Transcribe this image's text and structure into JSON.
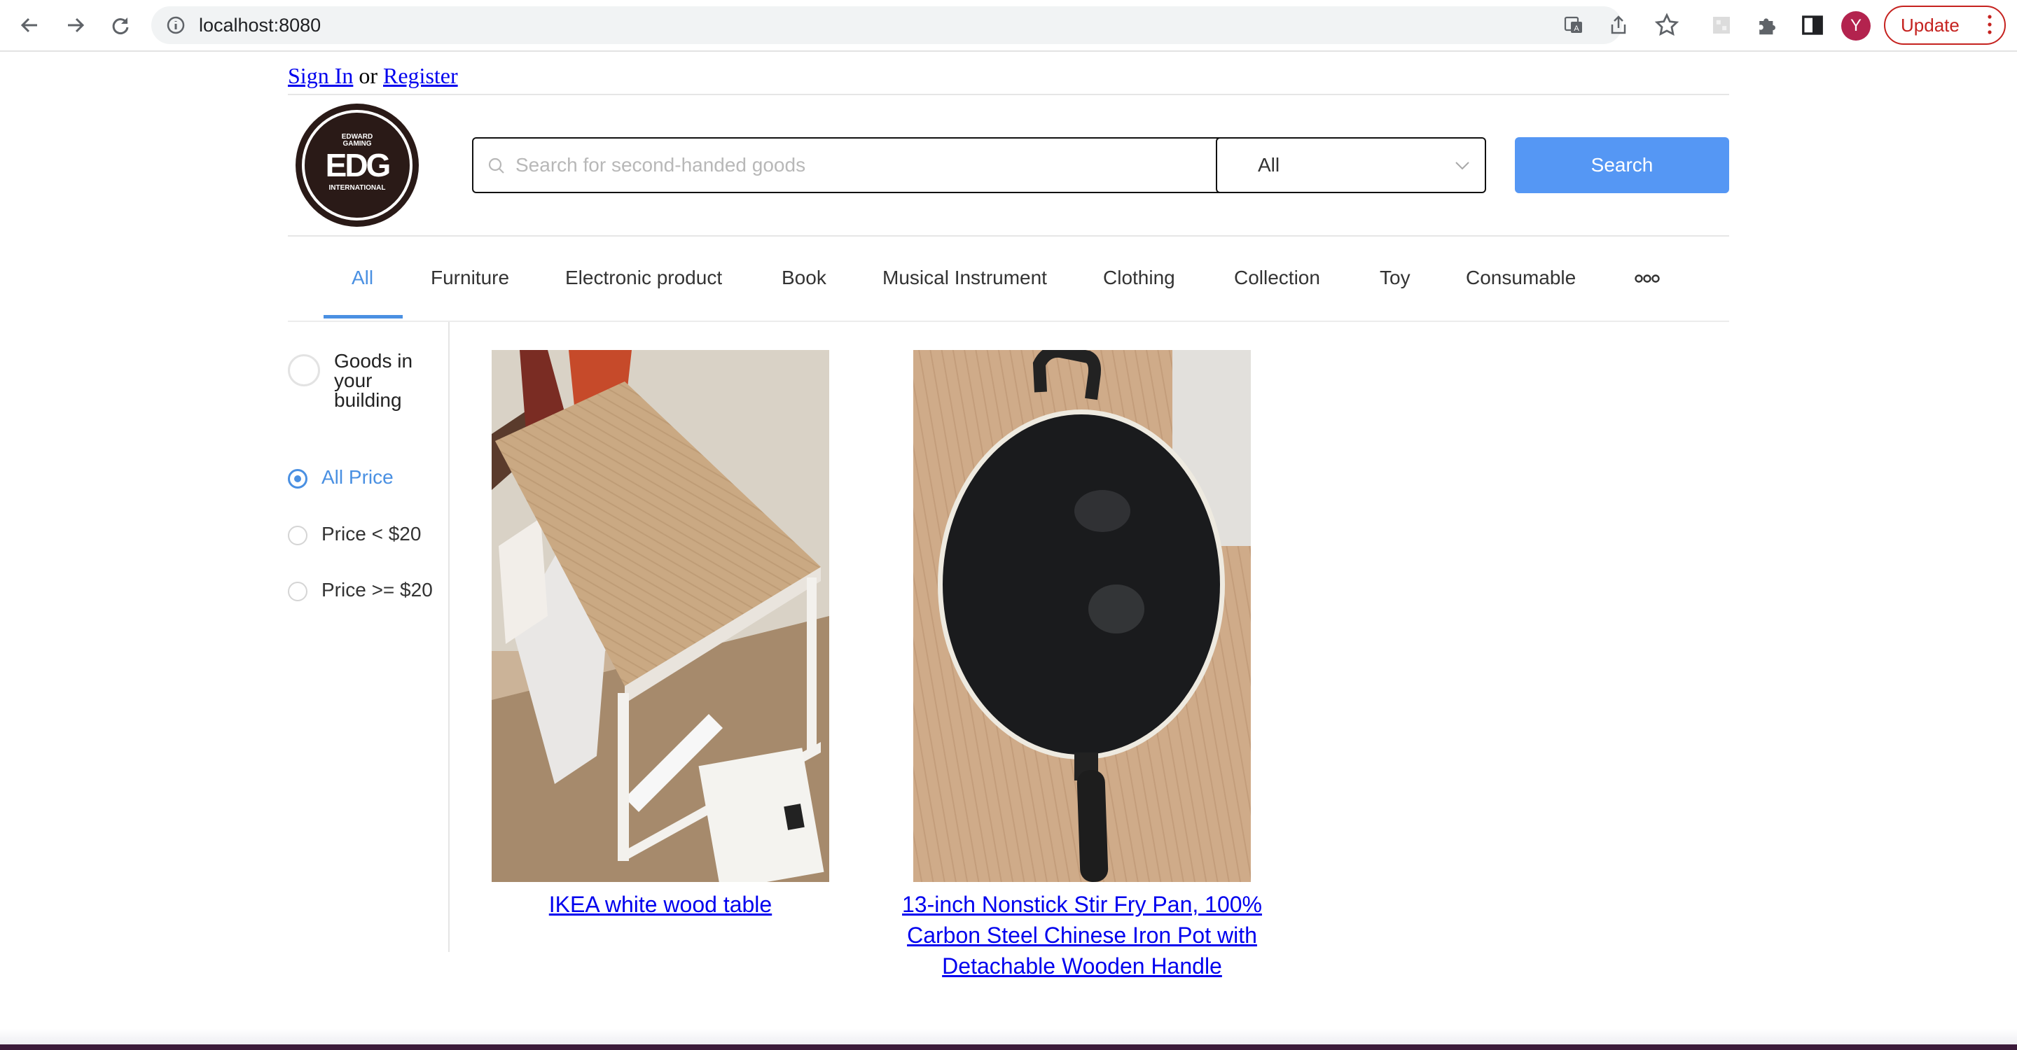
{
  "browser": {
    "url": "localhost:8080",
    "avatar_letter": "Y",
    "update_label": "Update",
    "icons": [
      "back-icon",
      "forward-icon",
      "reload-icon",
      "info-icon",
      "translate-icon",
      "share-icon",
      "star-icon",
      "extension-icon",
      "puzzle-icon",
      "sidepanel-icon",
      "menu-dots-icon"
    ]
  },
  "auth": {
    "sign_in": "Sign In",
    "or": "or",
    "register": "Register"
  },
  "logo": {
    "top": "EDWARD",
    "top2": "GAMING",
    "main": "EDG",
    "bottom": "INTERNATIONAL"
  },
  "search": {
    "placeholder": "Search for second-handed goods",
    "category_value": "All",
    "button_label": "Search"
  },
  "tabs": [
    {
      "label": "All",
      "active": true
    },
    {
      "label": "Furniture"
    },
    {
      "label": "Electronic product"
    },
    {
      "label": "Book"
    },
    {
      "label": "Musical Instrument"
    },
    {
      "label": "Clothing"
    },
    {
      "label": "Collection"
    },
    {
      "label": "Toy"
    },
    {
      "label": "Consumable"
    }
  ],
  "sidebar": {
    "toggle_label": "Goods in your building",
    "price_options": [
      {
        "label": "All Price",
        "checked": true
      },
      {
        "label": "Price < $20"
      },
      {
        "label": "Price >= $20"
      }
    ]
  },
  "products": [
    {
      "title": "IKEA white wood table"
    },
    {
      "title": "13-inch Nonstick Stir Fry Pan, 100% Carbon Steel Chinese Iron Pot with Detachable Wooden Handle"
    }
  ],
  "colors": {
    "accent": "#4a90e2",
    "search_button": "#5597f4",
    "link": "#0000ee",
    "update_red": "#c5221f"
  }
}
